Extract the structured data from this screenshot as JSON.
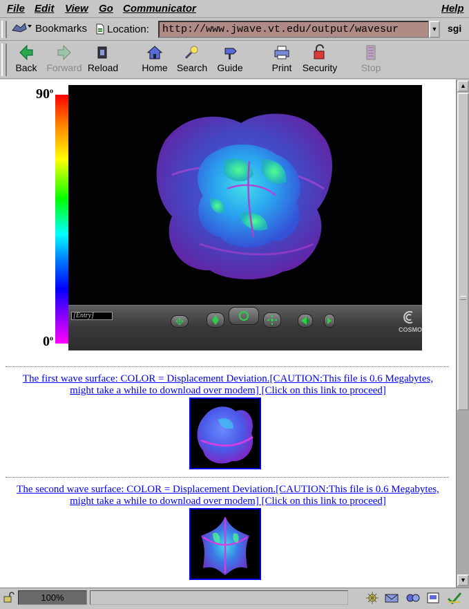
{
  "menu": {
    "file": "File",
    "edit": "Edit",
    "view": "View",
    "go": "Go",
    "communicator": "Communicator",
    "help": "Help"
  },
  "location_bar": {
    "bookmarks_label": "Bookmarks",
    "location_label": "Location:",
    "url": "http://www.jwave.vt.edu/output/wavesur",
    "brand": "sgi"
  },
  "toolbar": {
    "back": "Back",
    "forward": "Forward",
    "reload": "Reload",
    "home": "Home",
    "search": "Search",
    "guide": "Guide",
    "print": "Print",
    "security": "Security",
    "stop": "Stop"
  },
  "content": {
    "colorbar_top_label": "90",
    "colorbar_bottom_label": "0",
    "degree_mark": "o",
    "vrml_entry": "[Entry]",
    "vrml_brand": "COSMO",
    "link1": "The first wave surface: COLOR = Displacement Deviation.[CAUTION:This file is 0.6 Megabytes, might take a while to download over modem] [Click on this link to proceed]",
    "link2": "The second wave surface: COLOR = Displacement Deviation.[CAUTION:This file is 0.6 Megabytes, might take a while to download over modem] [Click on this link to proceed]"
  },
  "status": {
    "progress_value": "100%",
    "message": ""
  },
  "colors": {
    "link": "#0000ee",
    "url_field_bg": "#b08a85",
    "chrome": "#c6c6c6"
  }
}
